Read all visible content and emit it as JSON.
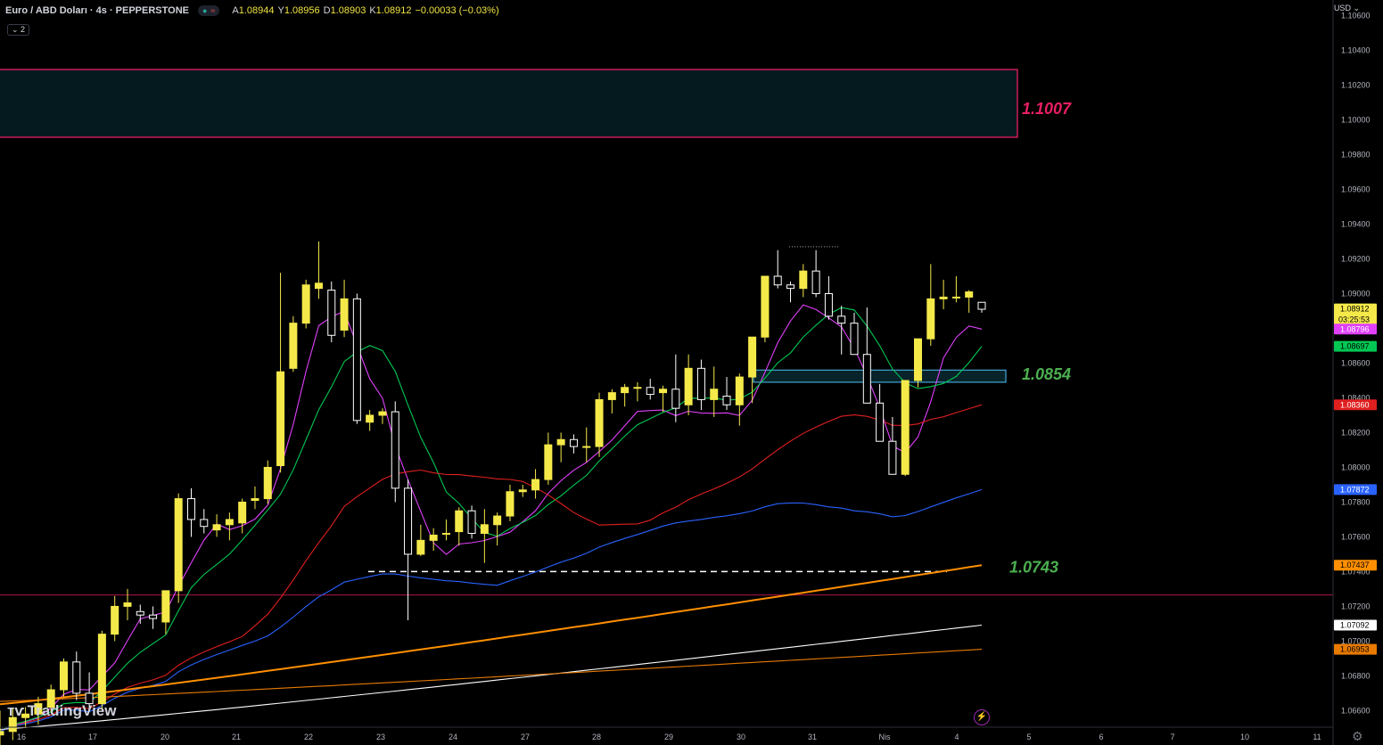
{
  "header": {
    "symbol": "Euro / ABD Doları · 4s · PEPPERSTONE",
    "ohlc": [
      {
        "label": "A",
        "value": "1.08944"
      },
      {
        "label": "Y",
        "value": "1.08956"
      },
      {
        "label": "D",
        "value": "1.08903"
      },
      {
        "label": "K",
        "value": "1.08912"
      },
      {
        "label": "",
        "value": "−0.00033 (−0.03%)"
      }
    ],
    "indicator_count": "2",
    "currency": "USD"
  },
  "brand": "TradingView",
  "chart_data": {
    "type": "candlestick",
    "price_axis": {
      "min": 1.0652,
      "max": 1.1069,
      "ticks": [
        "1.10600",
        "1.10400",
        "1.10200",
        "1.10000",
        "1.09800",
        "1.09600",
        "1.09400",
        "1.09200",
        "1.09000",
        "1.08800",
        "1.08600",
        "1.08400",
        "1.08200",
        "1.08000",
        "1.07800",
        "1.07600",
        "1.07400",
        "1.07200",
        "1.07000",
        "1.06800",
        "1.06600"
      ]
    },
    "x_labels": [
      "16",
      "17",
      "20",
      "21",
      "22",
      "23",
      "24",
      "27",
      "28",
      "29",
      "30",
      "31",
      "Nis",
      "4",
      "5",
      "6",
      "7",
      "10",
      "11"
    ],
    "candles_ohlc": [
      [
        1.0646,
        1.066,
        1.0636,
        1.0648
      ],
      [
        1.0648,
        1.0661,
        1.0643,
        1.0656
      ],
      [
        1.0656,
        1.0662,
        1.065,
        1.0658
      ],
      [
        1.0658,
        1.0668,
        1.0652,
        1.0664
      ],
      [
        1.0662,
        1.0675,
        1.0659,
        1.0672
      ],
      [
        1.0672,
        1.069,
        1.0668,
        1.0688
      ],
      [
        1.0688,
        1.0694,
        1.0666,
        1.067
      ],
      [
        1.067,
        1.0682,
        1.066,
        1.0664
      ],
      [
        1.0664,
        1.0706,
        1.066,
        1.0704
      ],
      [
        1.0704,
        1.0726,
        1.07,
        1.072
      ],
      [
        1.072,
        1.073,
        1.0712,
        1.0722
      ],
      [
        1.0717,
        1.0721,
        1.071,
        1.0715
      ],
      [
        1.0715,
        1.072,
        1.0707,
        1.0713
      ],
      [
        1.0711,
        1.0728,
        1.0704,
        1.0729
      ],
      [
        1.0729,
        1.0785,
        1.0722,
        1.0782
      ],
      [
        1.0782,
        1.0788,
        1.076,
        1.077
      ],
      [
        1.077,
        1.0776,
        1.0762,
        1.0766
      ],
      [
        1.0764,
        1.0773,
        1.076,
        1.0767
      ],
      [
        1.0767,
        1.0774,
        1.0758,
        1.077
      ],
      [
        1.0768,
        1.0782,
        1.0762,
        1.078
      ],
      [
        1.0781,
        1.0789,
        1.0776,
        1.0782
      ],
      [
        1.0782,
        1.0804,
        1.0779,
        1.08
      ],
      [
        1.0801,
        1.0912,
        1.0797,
        1.0855
      ],
      [
        1.0857,
        1.0887,
        1.0855,
        1.0883
      ],
      [
        1.0883,
        1.0908,
        1.088,
        1.0905
      ],
      [
        1.0903,
        1.093,
        1.0897,
        1.0906
      ],
      [
        1.0902,
        1.0907,
        1.0872,
        1.0876
      ],
      [
        1.0879,
        1.0908,
        1.0875,
        1.0897
      ],
      [
        1.0897,
        1.09,
        1.0825,
        1.0827
      ],
      [
        1.0826,
        1.0833,
        1.0821,
        1.083
      ],
      [
        1.083,
        1.0834,
        1.0825,
        1.0832
      ],
      [
        1.0832,
        1.0838,
        1.078,
        1.0788
      ],
      [
        1.0788,
        1.0793,
        1.0712,
        1.075
      ],
      [
        1.075,
        1.0767,
        1.0749,
        1.0758
      ],
      [
        1.0758,
        1.0765,
        1.0752,
        1.0761
      ],
      [
        1.0762,
        1.077,
        1.0758,
        1.0762
      ],
      [
        1.0763,
        1.0777,
        1.0755,
        1.0775
      ],
      [
        1.0775,
        1.0778,
        1.0759,
        1.0762
      ],
      [
        1.0762,
        1.0776,
        1.0745,
        1.0767
      ],
      [
        1.0767,
        1.0774,
        1.0755,
        1.0772
      ],
      [
        1.0772,
        1.079,
        1.0769,
        1.0786
      ],
      [
        1.0786,
        1.079,
        1.0783,
        1.0787
      ],
      [
        1.0787,
        1.0799,
        1.0782,
        1.0793
      ],
      [
        1.0793,
        1.082,
        1.079,
        1.0813
      ],
      [
        1.0813,
        1.082,
        1.0803,
        1.0816
      ],
      [
        1.0816,
        1.0819,
        1.0808,
        1.0812
      ],
      [
        1.0812,
        1.0823,
        1.0803,
        1.0812
      ],
      [
        1.0812,
        1.0843,
        1.0806,
        1.0839
      ],
      [
        1.0839,
        1.0845,
        1.0831,
        1.0843
      ],
      [
        1.0843,
        1.0848,
        1.0835,
        1.0846
      ],
      [
        1.0846,
        1.0849,
        1.0838,
        1.0846
      ],
      [
        1.0846,
        1.0851,
        1.0839,
        1.0842
      ],
      [
        1.0843,
        1.0847,
        1.0832,
        1.0845
      ],
      [
        1.0845,
        1.0865,
        1.0826,
        1.0834
      ],
      [
        1.0836,
        1.0865,
        1.083,
        1.0857
      ],
      [
        1.0857,
        1.0862,
        1.0833,
        1.0839
      ],
      [
        1.0839,
        1.0858,
        1.0829,
        1.0845
      ],
      [
        1.0841,
        1.0852,
        1.0833,
        1.0836
      ],
      [
        1.0836,
        1.0854,
        1.0824,
        1.0852
      ],
      [
        1.0852,
        1.0867,
        1.0837,
        1.0875
      ],
      [
        1.0875,
        1.089,
        1.0872,
        1.091
      ],
      [
        1.091,
        1.0925,
        1.0903,
        1.0905
      ],
      [
        1.0905,
        1.0907,
        1.0895,
        1.0903
      ],
      [
        1.0903,
        1.0917,
        1.0898,
        1.0913
      ],
      [
        1.0913,
        1.0925,
        1.0898,
        1.09
      ],
      [
        1.09,
        1.091,
        1.0885,
        1.0887
      ],
      [
        1.0887,
        1.0893,
        1.0865,
        1.0883
      ],
      [
        1.0883,
        1.0889,
        1.0865,
        1.0865
      ],
      [
        1.0865,
        1.0892,
        1.0855,
        1.0837
      ],
      [
        1.0837,
        1.0848,
        1.0817,
        1.0815
      ],
      [
        1.0815,
        1.0829,
        1.0796,
        1.0796
      ],
      [
        1.0796,
        1.0821,
        1.0795,
        1.085
      ],
      [
        1.085,
        1.087,
        1.0846,
        1.0874
      ],
      [
        1.0874,
        1.0917,
        1.087,
        1.0897
      ],
      [
        1.0897,
        1.0908,
        1.0891,
        1.0898
      ],
      [
        1.0898,
        1.091,
        1.0895,
        1.0898
      ],
      [
        1.0898,
        1.0902,
        1.0889,
        1.0901
      ],
      [
        1.0895,
        1.0895,
        1.0889,
        1.0891
      ]
    ],
    "levels": [
      {
        "label": "1.1007",
        "price": 1.1007
      },
      {
        "label": "1.0854",
        "price": 1.0854
      },
      {
        "label": "1.0743",
        "price": 1.0743
      }
    ],
    "zones": [
      {
        "from": 1.099,
        "to": 1.1029
      },
      {
        "from": 1.0849,
        "to": 1.0856
      }
    ],
    "red_line": 1.07265,
    "price_badges": [
      {
        "label": "1.08912",
        "extra": "03:25:53",
        "color": "#f5e94a",
        "text": "#000000"
      },
      {
        "label": "1.08796",
        "color": "#e040fb",
        "text": "#ffffff"
      },
      {
        "label": "1.08697",
        "color": "#00c853",
        "text": "#000000"
      },
      {
        "label": "1.08360",
        "color": "#e01f1f",
        "text": "#ffffff"
      },
      {
        "label": "1.07872",
        "color": "#2962ff",
        "text": "#ffffff"
      },
      {
        "label": "1.07437",
        "color": "#ff8f00",
        "text": "#000000"
      },
      {
        "label": "1.07092",
        "color": "#ffffff",
        "text": "#000000"
      },
      {
        "label": "1.06953",
        "color": "#e87a00",
        "text": "#000000"
      }
    ],
    "moving_averages": [
      {
        "color": "#e040fb",
        "end": 1.08796
      },
      {
        "color": "#00c853",
        "end": 1.08697
      },
      {
        "color": "#e01f1f",
        "end": 1.0836
      },
      {
        "color": "#2962ff",
        "end": 1.07872
      },
      {
        "color": "#ff8f00",
        "end": 1.07437
      },
      {
        "color": "#ffffff",
        "end": 1.07092
      },
      {
        "color": "#e87a00",
        "end": 1.06953
      }
    ],
    "colors": {
      "up": "#f5e94a",
      "down": "#000000",
      "down_border": "#ffffff",
      "zone_border": "#e91e63",
      "level_red": "#e91e63",
      "level_green": "#4caf50"
    }
  }
}
